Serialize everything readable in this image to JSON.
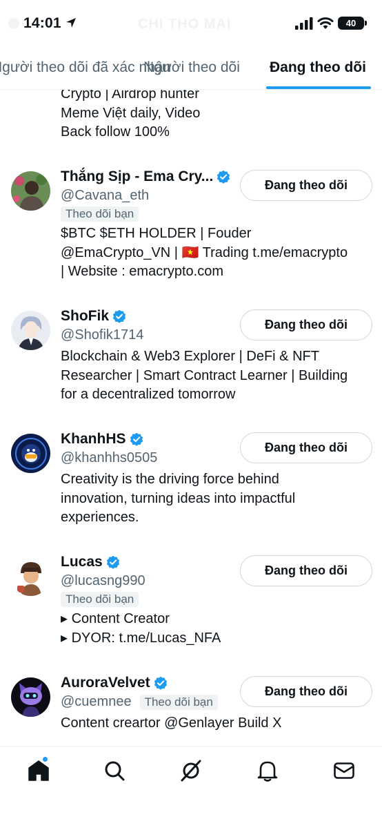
{
  "status_bar": {
    "time": "14:01",
    "battery": "40",
    "background_title": "CHI THO MAI"
  },
  "tabs": [
    {
      "label": "Người theo dõi đã xác nhận",
      "active": false
    },
    {
      "label": "Người theo dõi",
      "active": false
    },
    {
      "label": "Đang theo dõi",
      "active": true
    }
  ],
  "top_bio_lines": [
    "Crypto | Airdrop hunter",
    "Meme Việt daily, Video",
    "Back follow 100%"
  ],
  "users": [
    {
      "name": "Thắng Sịp - Ema Cry...",
      "handle": "@Cavana_eth",
      "follows_you": "Theo dõi bạn",
      "button": "Đang theo dõi",
      "verified": true,
      "avatar": "avatar-thang-sip",
      "bio_lines": [
        "$BTC $ETH HOLDER | Fouder",
        "@EmaCrypto_VN | 🇻🇳 Trading t.me/emacrypto",
        "| Website : emacrypto.com"
      ]
    },
    {
      "name": "ShoFik",
      "handle": "@Shofik1714",
      "follows_you": "",
      "button": "Đang theo dõi",
      "verified": true,
      "avatar": "avatar-shofik",
      "bio_lines": [
        "Blockchain & Web3 Explorer | DeFi & NFT",
        "Researcher | Smart Contract Learner | Building",
        "for a decentralized tomorrow"
      ]
    },
    {
      "name": "KhanhHS",
      "handle": "@khanhhs0505",
      "follows_you": "",
      "button": "Đang theo dõi",
      "verified": true,
      "avatar": "avatar-khanhhs",
      "bio_lines": [
        "Creativity is the driving force behind",
        "innovation, turning ideas into impactful",
        "experiences."
      ]
    },
    {
      "name": "Lucas",
      "handle": "@lucasng990",
      "follows_you": "Theo dõi bạn",
      "button": "Đang theo dõi",
      "verified": true,
      "avatar": "avatar-lucas",
      "bio_lines": [
        "▸ Content Creator",
        "▸ DYOR: t.me/Lucas_NFA"
      ]
    },
    {
      "name": "AuroraVelvet",
      "handle": "@cuemnee",
      "follows_you": "Theo dõi bạn",
      "button": "Đang theo dõi",
      "verified": true,
      "avatar": "avatar-auroravelvet",
      "bio_lines": [
        "Content creartor @Genlayer Build X"
      ]
    }
  ],
  "bottom_nav": {
    "items": [
      "home-icon",
      "search-icon",
      "grok-icon",
      "notifications-icon",
      "messages-icon"
    ],
    "home_has_badge": true
  },
  "colors": {
    "accent": "#1d9bf0",
    "text_primary": "#0f1419",
    "text_secondary": "#536471",
    "border": "#cfd9de"
  }
}
